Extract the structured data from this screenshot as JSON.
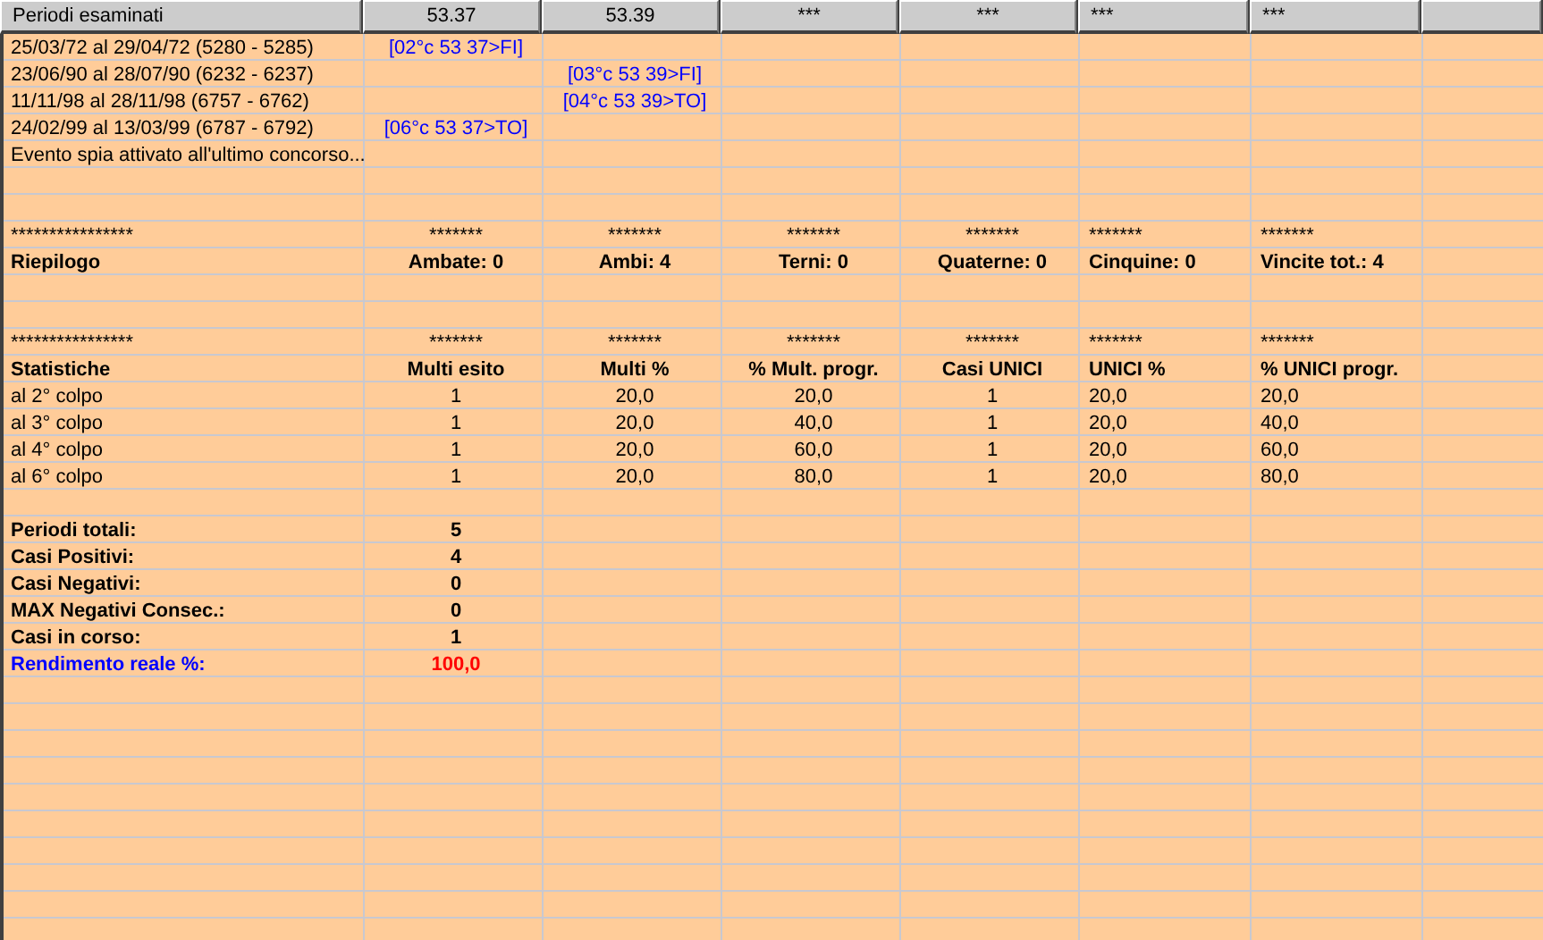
{
  "columns": [
    "Periodi esaminati",
    "53.37",
    "53.39",
    "***",
    "***",
    "***",
    "***"
  ],
  "rows": [
    {
      "kind": "plain",
      "cells": [
        {
          "text": "25/03/72 al 29/04/72  (5280 - 5285)"
        },
        {
          "text": "[02°c 53 37>FI]",
          "kind": "link"
        },
        null,
        null,
        null,
        null,
        null
      ]
    },
    {
      "kind": "plain",
      "cells": [
        {
          "text": "23/06/90 al 28/07/90  (6232 - 6237)"
        },
        null,
        {
          "text": "[03°c 53 39>FI]",
          "kind": "link"
        },
        null,
        null,
        null,
        null
      ]
    },
    {
      "kind": "plain",
      "cells": [
        {
          "text": "11/11/98 al 28/11/98  (6757 - 6762)"
        },
        null,
        {
          "text": "[04°c 53 39>TO]",
          "kind": "link"
        },
        null,
        null,
        null,
        null
      ]
    },
    {
      "kind": "plain",
      "cells": [
        {
          "text": "24/02/99 al 13/03/99  (6787 - 6792)"
        },
        {
          "text": "[06°c 53 37>TO]",
          "kind": "link"
        },
        null,
        null,
        null,
        null,
        null
      ]
    },
    {
      "kind": "plain",
      "cells": [
        {
          "text": "Evento spia attivato all'ultimo concorso..."
        },
        null,
        null,
        null,
        null,
        null,
        null
      ]
    },
    {
      "kind": "blank"
    },
    {
      "kind": "blank"
    },
    {
      "kind": "plain",
      "cells": [
        {
          "text": "****************"
        },
        {
          "text": "*******"
        },
        {
          "text": "*******"
        },
        {
          "text": "*******"
        },
        {
          "text": "*******"
        },
        {
          "text": "*******"
        },
        {
          "text": "*******"
        }
      ]
    },
    {
      "kind": "bold",
      "cells": [
        {
          "text": "Riepilogo"
        },
        {
          "text": "Ambate: 0"
        },
        {
          "text": "Ambi: 4"
        },
        {
          "text": "Terni: 0"
        },
        {
          "text": "Quaterne: 0"
        },
        {
          "text": "Cinquine: 0"
        },
        {
          "text": "Vincite tot.: 4"
        }
      ]
    },
    {
      "kind": "blank"
    },
    {
      "kind": "blank"
    },
    {
      "kind": "plain",
      "cells": [
        {
          "text": "****************"
        },
        {
          "text": "*******"
        },
        {
          "text": "*******"
        },
        {
          "text": "*******"
        },
        {
          "text": "*******"
        },
        {
          "text": "*******"
        },
        {
          "text": "*******"
        }
      ]
    },
    {
      "kind": "bold",
      "cells": [
        {
          "text": "Statistiche"
        },
        {
          "text": "Multi esito"
        },
        {
          "text": "Multi %"
        },
        {
          "text": "% Mult. progr."
        },
        {
          "text": "Casi UNICI"
        },
        {
          "text": "UNICI %"
        },
        {
          "text": "% UNICI progr."
        }
      ]
    },
    {
      "kind": "plain",
      "cells": [
        {
          "text": "al 2° colpo"
        },
        {
          "text": "1"
        },
        {
          "text": "20,0"
        },
        {
          "text": "20,0"
        },
        {
          "text": "1"
        },
        {
          "text": "20,0"
        },
        {
          "text": "20,0"
        }
      ]
    },
    {
      "kind": "plain",
      "cells": [
        {
          "text": "al 3° colpo"
        },
        {
          "text": "1"
        },
        {
          "text": "20,0"
        },
        {
          "text": "40,0"
        },
        {
          "text": "1"
        },
        {
          "text": "20,0"
        },
        {
          "text": "40,0"
        }
      ]
    },
    {
      "kind": "plain",
      "cells": [
        {
          "text": "al 4° colpo"
        },
        {
          "text": "1"
        },
        {
          "text": "20,0"
        },
        {
          "text": "60,0"
        },
        {
          "text": "1"
        },
        {
          "text": "20,0"
        },
        {
          "text": "60,0"
        }
      ]
    },
    {
      "kind": "plain",
      "cells": [
        {
          "text": "al 6° colpo"
        },
        {
          "text": "1"
        },
        {
          "text": "20,0"
        },
        {
          "text": "80,0"
        },
        {
          "text": "1"
        },
        {
          "text": "20,0"
        },
        {
          "text": "80,0"
        }
      ]
    },
    {
      "kind": "blank"
    },
    {
      "kind": "bold",
      "cells": [
        {
          "text": "Periodi totali:"
        },
        {
          "text": "5"
        },
        null,
        null,
        null,
        null,
        null
      ]
    },
    {
      "kind": "bold",
      "cells": [
        {
          "text": "Casi Positivi:"
        },
        {
          "text": "4"
        },
        null,
        null,
        null,
        null,
        null
      ]
    },
    {
      "kind": "bold",
      "cells": [
        {
          "text": "Casi Negativi:"
        },
        {
          "text": "0"
        },
        null,
        null,
        null,
        null,
        null
      ]
    },
    {
      "kind": "bold",
      "cells": [
        {
          "text": "MAX Negativi Consec.:"
        },
        {
          "text": "0"
        },
        null,
        null,
        null,
        null,
        null
      ]
    },
    {
      "kind": "bold",
      "cells": [
        {
          "text": "Casi in corso:"
        },
        {
          "text": "1"
        },
        null,
        null,
        null,
        null,
        null
      ]
    },
    {
      "kind": "bold",
      "cells": [
        {
          "text": "Rendimento reale %:",
          "kind": "accent"
        },
        {
          "text": "100,0",
          "kind": "alert"
        },
        null,
        null,
        null,
        null,
        null
      ]
    }
  ]
}
